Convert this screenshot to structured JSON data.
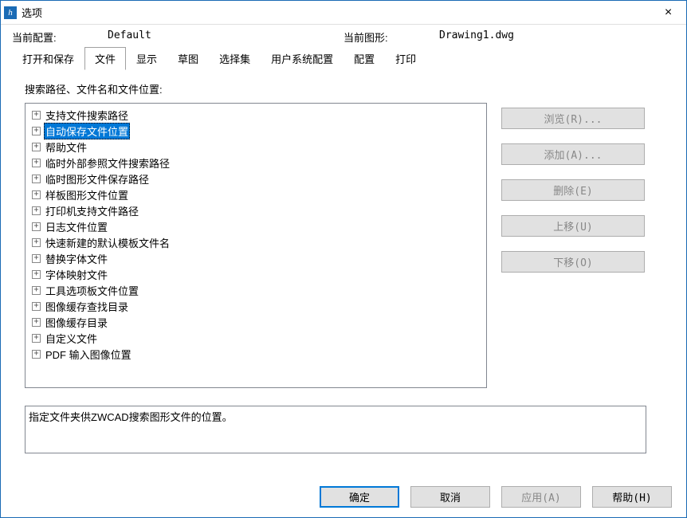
{
  "window": {
    "title": "选项",
    "close": "×"
  },
  "info": {
    "current_config_label": "当前配置:",
    "current_config_value": "Default",
    "current_drawing_label": "当前图形:",
    "current_drawing_value": "Drawing1.dwg"
  },
  "tabs": [
    {
      "label": "打开和保存",
      "active": false
    },
    {
      "label": "文件",
      "active": true
    },
    {
      "label": "显示",
      "active": false
    },
    {
      "label": "草图",
      "active": false
    },
    {
      "label": "选择集",
      "active": false
    },
    {
      "label": "用户系统配置",
      "active": false
    },
    {
      "label": "配置",
      "active": false
    },
    {
      "label": "打印",
      "active": false
    }
  ],
  "section_label": "搜索路径、文件名和文件位置:",
  "tree_items": [
    {
      "label": "支持文件搜索路径",
      "selected": false
    },
    {
      "label": "自动保存文件位置",
      "selected": true
    },
    {
      "label": "帮助文件",
      "selected": false
    },
    {
      "label": "临时外部参照文件搜索路径",
      "selected": false
    },
    {
      "label": "临时图形文件保存路径",
      "selected": false
    },
    {
      "label": "样板图形文件位置",
      "selected": false
    },
    {
      "label": "打印机支持文件路径",
      "selected": false
    },
    {
      "label": "日志文件位置",
      "selected": false
    },
    {
      "label": "快速新建的默认模板文件名",
      "selected": false
    },
    {
      "label": "替换字体文件",
      "selected": false
    },
    {
      "label": "字体映射文件",
      "selected": false
    },
    {
      "label": "工具选项板文件位置",
      "selected": false
    },
    {
      "label": "图像缓存查找目录",
      "selected": false
    },
    {
      "label": "图像缓存目录",
      "selected": false
    },
    {
      "label": "自定义文件",
      "selected": false
    },
    {
      "label": "PDF 输入图像位置",
      "selected": false
    }
  ],
  "side_buttons": {
    "browse": "浏览(R)...",
    "add": "添加(A)...",
    "delete": "删除(E)",
    "move_up": "上移(U)",
    "move_down": "下移(O)"
  },
  "description": "指定文件夹供ZWCAD搜索图形文件的位置。",
  "bottom_buttons": {
    "ok": "确定",
    "cancel": "取消",
    "apply": "应用(A)",
    "help": "帮助(H)"
  }
}
